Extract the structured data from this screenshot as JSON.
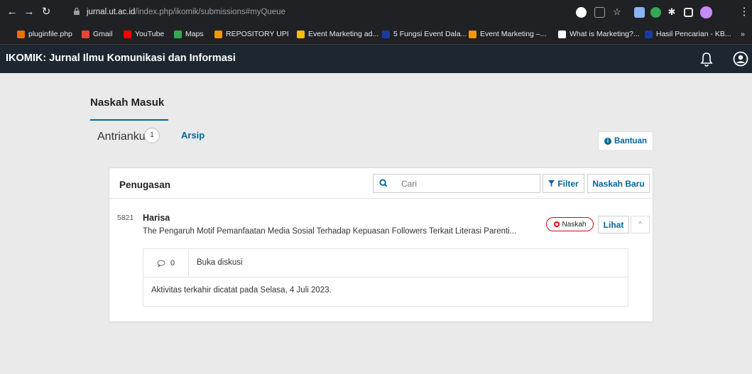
{
  "browser": {
    "url_host": "jurnal.ut.ac.id",
    "url_path": "/index.php/ikomik/submissions#myQueue",
    "bookmarks": [
      {
        "label": "pluginfile.php",
        "color": "#e8710a"
      },
      {
        "label": "Gmail",
        "color": "#ea4335"
      },
      {
        "label": "YouTube",
        "color": "#ff0000"
      },
      {
        "label": "Maps",
        "color": "#34a853"
      },
      {
        "label": "REPOSITORY UPI",
        "color": "#f29900"
      },
      {
        "label": "Event Marketing ad...",
        "color": "#fbbc04"
      },
      {
        "label": "5 Fungsi Event Dala...",
        "color": "#1a3a9c"
      },
      {
        "label": "Event Marketing –...",
        "color": "#f29900"
      },
      {
        "label": "What is Marketing?...",
        "color": "#ffffff"
      },
      {
        "label": "Hasil Pencarian - KB...",
        "color": "#1a3a9c"
      }
    ]
  },
  "header": {
    "journal_title": "IKOMIK: Jurnal Ilmu Komunikasi dan Informasi"
  },
  "page": {
    "title": "Naskah Masuk",
    "tabs": [
      {
        "label": "Antrianku",
        "count": "1"
      },
      {
        "label": "Arsip"
      }
    ],
    "help_label": "Bantuan"
  },
  "panel": {
    "title": "Penugasan",
    "search_placeholder": "Cari",
    "filter_label": "Filter",
    "new_label": "Naskah Baru"
  },
  "submission": {
    "id": "5821",
    "author": "Harisa",
    "title": "The Pengaruh Motif Pemanfaatan Media Sosial Terhadap Kepuasan Followers Terkait Literasi Parenti...",
    "stage": "Naskah",
    "view_label": "Lihat",
    "discussion_count": "0",
    "discussion_link": "Buka diskusi",
    "last_activity": "Aktivitas terkahir dicatat pada Selasa, 4 Juli 2023."
  },
  "colors": {
    "accent": "#006798",
    "header_bg": "#1d2731",
    "stage_red": "#d00a0a"
  }
}
